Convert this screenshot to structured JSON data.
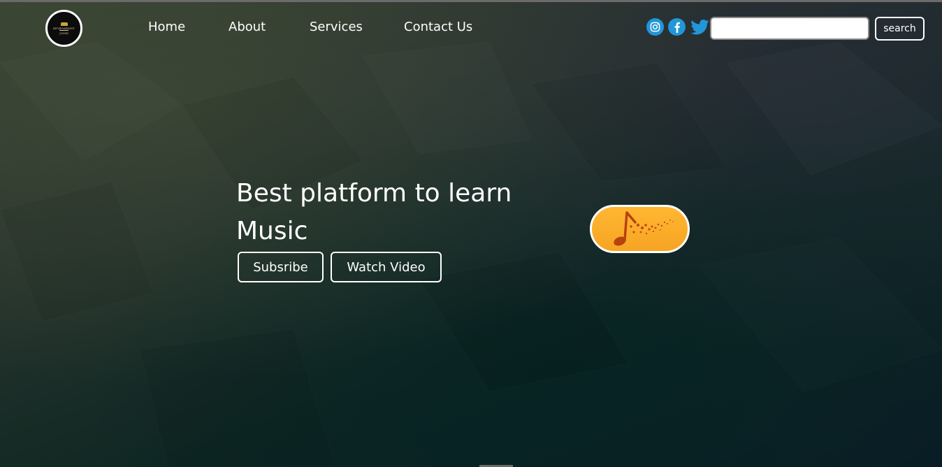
{
  "logo": {
    "text": "KEYBOARDIST",
    "subtext": "JOSHI"
  },
  "nav": {
    "items": [
      {
        "label": "Home"
      },
      {
        "label": "About"
      },
      {
        "label": "Services"
      },
      {
        "label": "Contact Us"
      }
    ]
  },
  "social": {
    "icons": [
      {
        "name": "instagram-icon",
        "color": "#2196d9"
      },
      {
        "name": "facebook-icon",
        "color": "#2196d9"
      },
      {
        "name": "twitter-icon",
        "color": "#2196d9"
      }
    ]
  },
  "search": {
    "value": "",
    "placeholder": "",
    "button_label": "search"
  },
  "hero": {
    "title": "Best platform to learn Music",
    "subscribe_label": "Subsribe",
    "watch_label": "Watch Video",
    "badge_icon": "music-note-icon",
    "badge_color": "#f9ab28"
  }
}
